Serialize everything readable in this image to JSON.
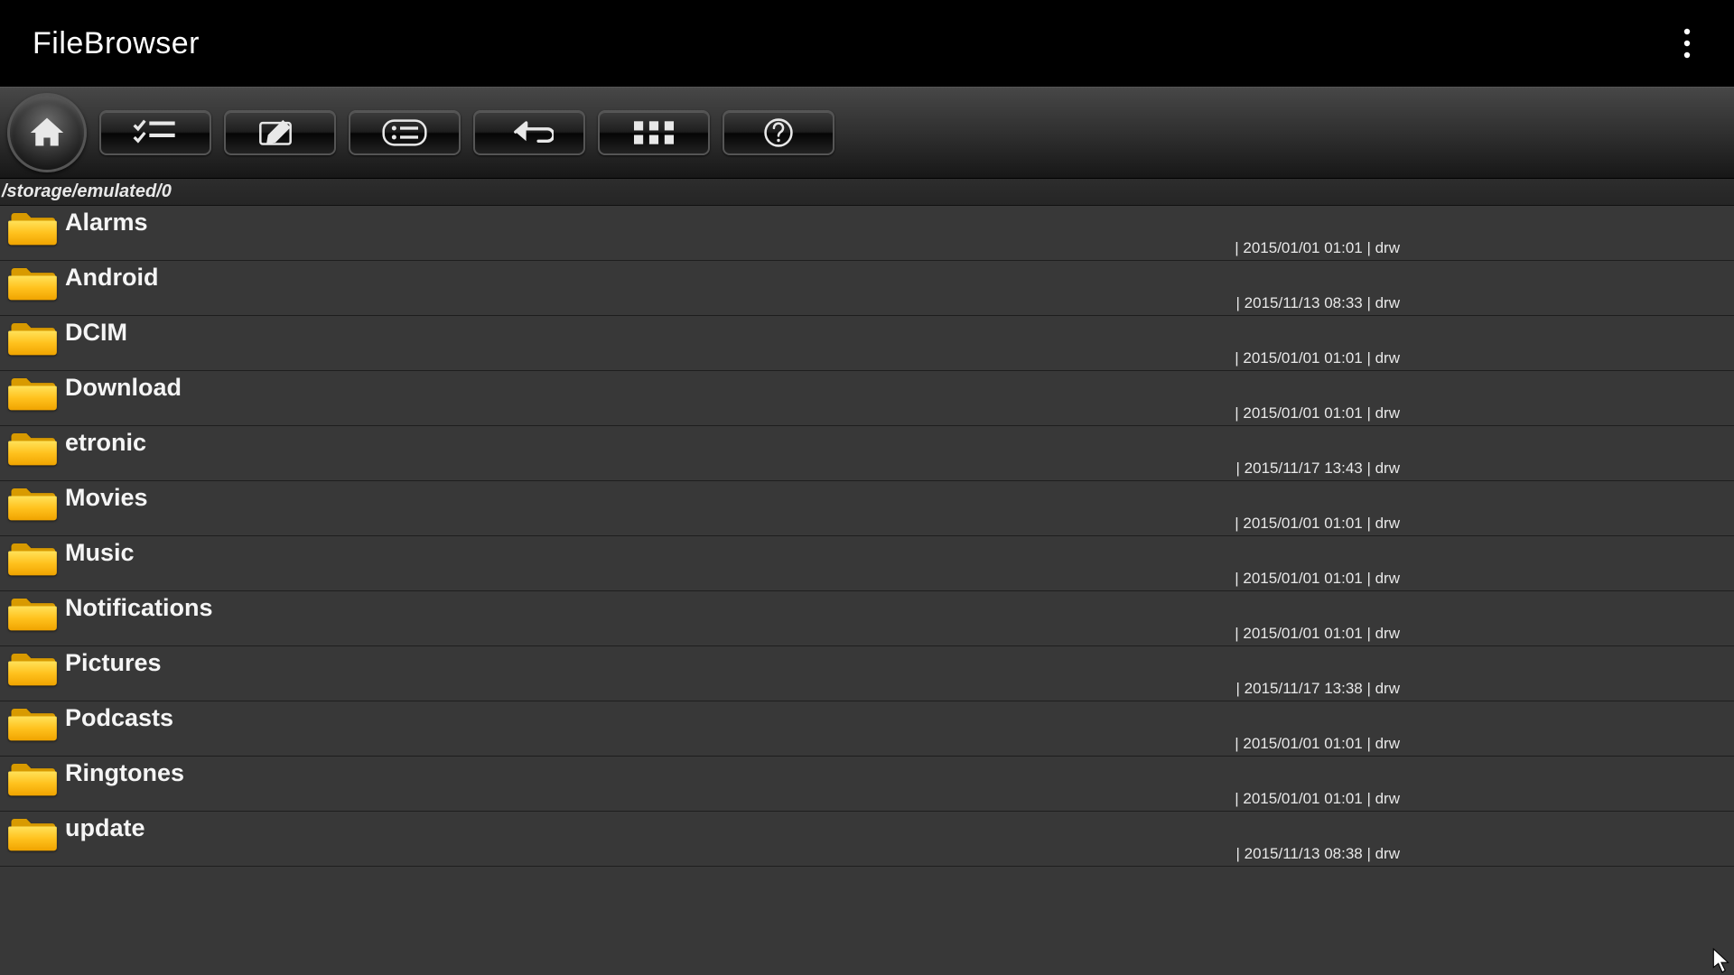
{
  "title": "FileBrowser",
  "path": "/storage/emulated/0",
  "files": [
    {
      "name": "Alarms",
      "meta": "| 2015/01/01 01:01 | drw"
    },
    {
      "name": "Android",
      "meta": "| 2015/11/13 08:33 | drw"
    },
    {
      "name": "DCIM",
      "meta": "| 2015/01/01 01:01 | drw"
    },
    {
      "name": "Download",
      "meta": "| 2015/01/01 01:01 | drw"
    },
    {
      "name": "etronic",
      "meta": "| 2015/11/17 13:43 | drw"
    },
    {
      "name": "Movies",
      "meta": "| 2015/01/01 01:01 | drw"
    },
    {
      "name": "Music",
      "meta": "| 2015/01/01 01:01 | drw"
    },
    {
      "name": "Notifications",
      "meta": "| 2015/01/01 01:01 | drw"
    },
    {
      "name": "Pictures",
      "meta": "| 2015/11/17 13:38 | drw"
    },
    {
      "name": "Podcasts",
      "meta": "| 2015/01/01 01:01 | drw"
    },
    {
      "name": "Ringtones",
      "meta": "| 2015/01/01 01:01 | drw"
    },
    {
      "name": "update",
      "meta": "| 2015/11/13 08:38 | drw"
    }
  ]
}
